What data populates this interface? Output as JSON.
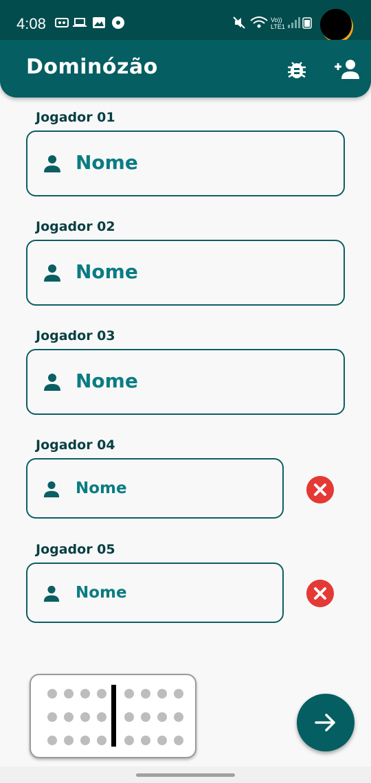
{
  "status_bar": {
    "time": "4:08",
    "icons": [
      "voicemail-icon",
      "laptop-icon",
      "image-icon",
      "notification-icon",
      "mute-icon",
      "wifi-icon",
      "volte-icon",
      "signal-icon",
      "battery-icon"
    ],
    "volte_label": "Vo)) LTE1"
  },
  "app_bar": {
    "title": "Dominózão",
    "actions": [
      "bug-icon",
      "add-user-icon"
    ]
  },
  "players": [
    {
      "label": "Jogador 01",
      "placeholder": "Nome",
      "removable": false
    },
    {
      "label": "Jogador 02",
      "placeholder": "Nome",
      "removable": false
    },
    {
      "label": "Jogador 03",
      "placeholder": "Nome",
      "removable": false
    },
    {
      "label": "Jogador 04",
      "placeholder": "Nome",
      "removable": true
    },
    {
      "label": "Jogador 05",
      "placeholder": "Nome",
      "removable": true
    }
  ],
  "colors": {
    "primary": "#055e61",
    "label": "#073f42",
    "placeholder": "#0a7c82",
    "remove": "#e53935"
  },
  "fab": {
    "icon": "arrow-right-icon"
  },
  "logo": {
    "icon": "domino-tile-icon",
    "pips_per_half": 12
  }
}
